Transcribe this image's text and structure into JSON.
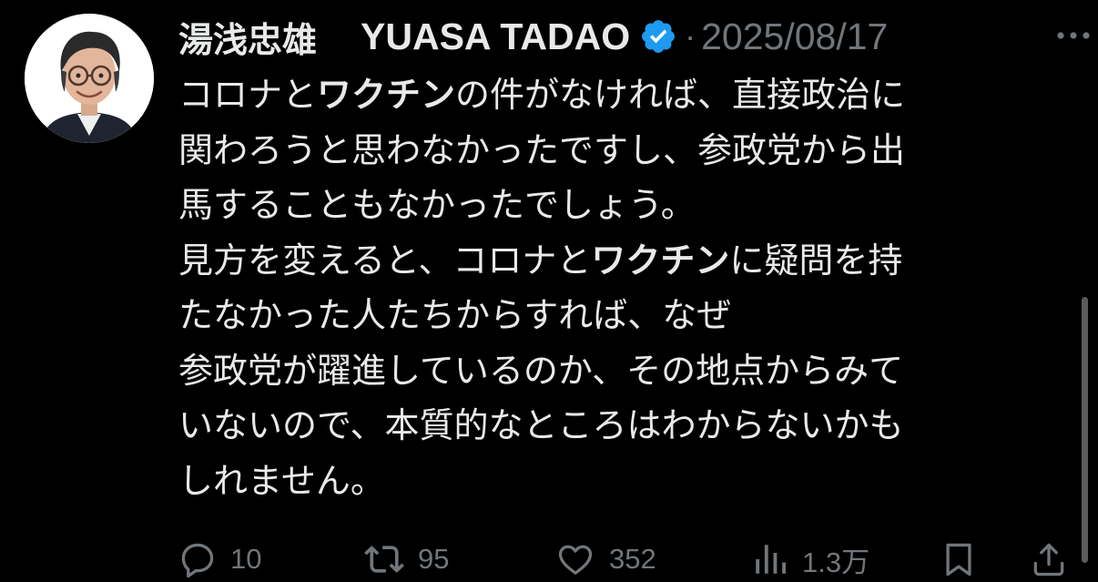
{
  "post": {
    "display_name": "湯浅忠雄",
    "display_name_en": "YUASA TADAO",
    "separator": "·",
    "date": "2025/08/17",
    "verified_color": "#1d9bf0",
    "lines": [
      [
        {
          "t": "コロナと",
          "b": false
        },
        {
          "t": "ワクチン",
          "b": true
        },
        {
          "t": "の件がなければ、直接政治に",
          "b": false
        }
      ],
      [
        {
          "t": "関わろうと思わなかったですし、参政党から出",
          "b": false
        }
      ],
      [
        {
          "t": "馬することもなかったでしょう。",
          "b": false
        }
      ],
      [
        {
          "t": "見方を変えると、コロナと",
          "b": false
        },
        {
          "t": "ワクチン",
          "b": true
        },
        {
          "t": "に疑問を持",
          "b": false
        }
      ],
      [
        {
          "t": "たなかった人たちからすれば、なぜ",
          "b": false
        }
      ],
      [
        {
          "t": "参政党が躍進しているのか、その地点からみて",
          "b": false
        }
      ],
      [
        {
          "t": "いないので、本質的なところはわからないかも",
          "b": false
        }
      ],
      [
        {
          "t": "しれません。",
          "b": false
        }
      ]
    ]
  },
  "actions": {
    "replies": "10",
    "reposts": "95",
    "likes": "352",
    "views": "1.3万"
  },
  "icons": {
    "more": "more-icon",
    "reply": "reply-icon",
    "repost": "repost-icon",
    "like": "like-icon",
    "views": "views-icon",
    "bookmark": "bookmark-icon",
    "share": "share-icon"
  }
}
